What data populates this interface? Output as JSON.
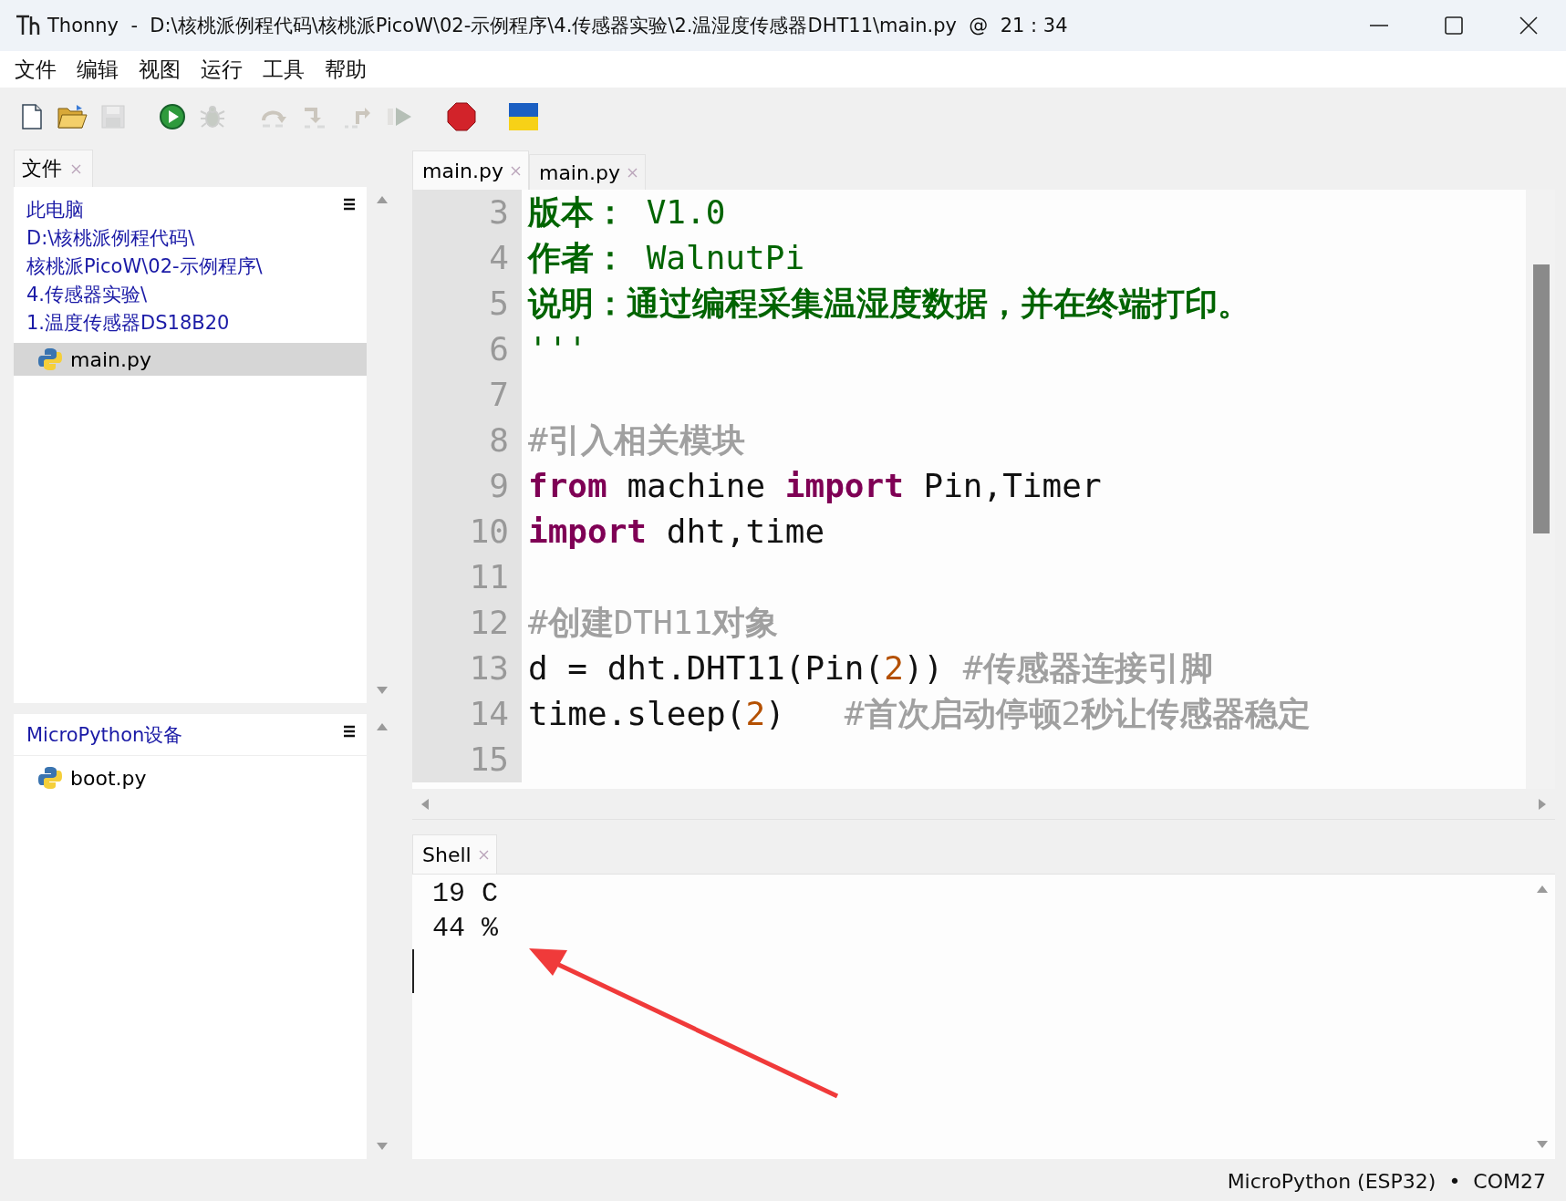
{
  "window": {
    "app": "Thonny",
    "title": "  -  D:\\核桃派例程代码\\核桃派PicoW\\02-示例程序\\4.传感器实验\\2.温湿度传感器DHT11\\main.py  @  21 : 34"
  },
  "menu": [
    "文件",
    "编辑",
    "视图",
    "运行",
    "工具",
    "帮助"
  ],
  "toolbar": [
    {
      "kind": "new",
      "disabled": false
    },
    {
      "kind": "open",
      "disabled": false
    },
    {
      "kind": "save",
      "disabled": true
    },
    {
      "kind": "run",
      "disabled": false
    },
    {
      "kind": "debug",
      "disabled": true
    },
    {
      "kind": "step-over",
      "disabled": true
    },
    {
      "kind": "step-into",
      "disabled": true
    },
    {
      "kind": "step-out",
      "disabled": true
    },
    {
      "kind": "resume",
      "disabled": true
    },
    {
      "kind": "stop",
      "disabled": false
    },
    {
      "kind": "flag",
      "disabled": false
    }
  ],
  "files_panel": {
    "tab": "文件",
    "computer": {
      "label": "此电脑",
      "path": [
        "D:\\核桃派例程代码\\",
        "核桃派PicoW\\02-示例程序\\",
        "4.传感器实验\\",
        "1.温度传感器DS18B20"
      ],
      "files": [
        {
          "name": "main.py",
          "selected": true
        }
      ]
    },
    "device": {
      "label": "MicroPython设备",
      "files": [
        {
          "name": "boot.py",
          "selected": false
        }
      ]
    }
  },
  "editor": {
    "tabs": [
      {
        "label": "main.py",
        "selected": true
      },
      {
        "label": "main.py",
        "selected": false
      }
    ],
    "lines": [
      {
        "number": "3",
        "tokens": [
          {
            "text": "版本：",
            "kind": "doc-bold"
          },
          {
            "text": " V1.0",
            "kind": "doc"
          }
        ]
      },
      {
        "number": "4",
        "tokens": [
          {
            "text": "作者：",
            "kind": "doc-bold"
          },
          {
            "text": " WalnutPi",
            "kind": "doc"
          }
        ]
      },
      {
        "number": "5",
        "tokens": [
          {
            "text": "说明：通过编程采集温湿度数据，并在终端打印。",
            "kind": "doc-bold"
          }
        ]
      },
      {
        "number": "6",
        "tokens": [
          {
            "text": "'''",
            "kind": "doc"
          }
        ]
      },
      {
        "number": "7"
      },
      {
        "number": "8",
        "tokens": [
          {
            "text": "#",
            "kind": "comment"
          },
          {
            "text": "引入相关模块",
            "kind": "comment-bold"
          }
        ]
      },
      {
        "number": "9",
        "tokens": [
          {
            "text": "from",
            "kind": "keyword"
          },
          {
            "text": " machine ",
            "kind": "plain"
          },
          {
            "text": "import",
            "kind": "keyword"
          },
          {
            "text": " Pin,Timer",
            "kind": "plain"
          }
        ]
      },
      {
        "number": "10",
        "tokens": [
          {
            "text": "import",
            "kind": "keyword"
          },
          {
            "text": " dht,time",
            "kind": "plain"
          }
        ]
      },
      {
        "number": "11"
      },
      {
        "number": "12",
        "tokens": [
          {
            "text": "#",
            "kind": "comment"
          },
          {
            "text": "创建",
            "kind": "comment-bold"
          },
          {
            "text": "DTH11",
            "kind": "comment"
          },
          {
            "text": "对象",
            "kind": "comment-bold"
          }
        ]
      },
      {
        "number": "13",
        "tokens": [
          {
            "text": "d = dht.DHT11(Pin(",
            "kind": "plain"
          },
          {
            "text": "2",
            "kind": "number"
          },
          {
            "text": ")) ",
            "kind": "plain"
          },
          {
            "text": "#",
            "kind": "comment"
          },
          {
            "text": "传感器连接引脚",
            "kind": "comment-bold"
          }
        ]
      },
      {
        "number": "14",
        "tokens": [
          {
            "text": "time.sleep(",
            "kind": "plain"
          },
          {
            "text": "2",
            "kind": "number"
          },
          {
            "text": ")   ",
            "kind": "plain"
          },
          {
            "text": "#",
            "kind": "comment"
          },
          {
            "text": "首次启动停顿",
            "kind": "comment-bold"
          },
          {
            "text": "2",
            "kind": "comment"
          },
          {
            "text": "秒让传感器稳定",
            "kind": "comment-bold"
          }
        ]
      },
      {
        "number": "15"
      }
    ]
  },
  "shell": {
    "tab": "Shell",
    "lines": [
      "19 C",
      "44 %"
    ]
  },
  "status_bar": "MicroPython (ESP32)  •  COM27"
}
